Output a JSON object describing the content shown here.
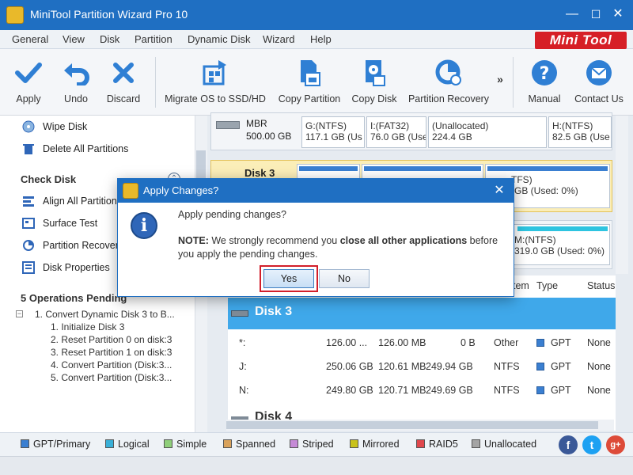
{
  "window": {
    "title": "MiniTool Partition Wizard Pro 10",
    "minimize": "—",
    "maximize": "☐",
    "close": "✕"
  },
  "menu": [
    "General",
    "View",
    "Disk",
    "Partition",
    "Dynamic Disk",
    "Wizard",
    "Help"
  ],
  "logo": "Mini Tool",
  "toolbar": {
    "apply": "Apply",
    "undo": "Undo",
    "discard": "Discard",
    "migrate": "Migrate OS to SSD/HD",
    "copy_partition": "Copy Partition",
    "copy_disk": "Copy Disk",
    "partition_recovery": "Partition Recovery",
    "more": "»",
    "manual": "Manual",
    "contact": "Contact Us"
  },
  "left": {
    "items_top": [
      "Wipe Disk",
      "Delete All Partitions"
    ],
    "check_disk_title": "Check Disk",
    "check_items": [
      "Align All Partitions",
      "Surface Test",
      "Partition Recovery",
      "Disk Properties"
    ],
    "ops_title": "5 Operations Pending",
    "ops": [
      "1. Convert Dynamic Disk 3 to B...",
      "1. Initialize Disk 3",
      "2. Reset Partition 0 on disk:3",
      "3. Reset Partition 1 on disk:3",
      "4. Convert Partition (Disk:3...",
      "5. Convert Partition (Disk:3..."
    ]
  },
  "disk2": {
    "type": "MBR",
    "size": "500.00 GB",
    "parts": [
      {
        "name": "G:(NTFS)",
        "detail": "117.1 GB (Us"
      },
      {
        "name": "I:(FAT32)",
        "detail": "76.0 GB (Use"
      },
      {
        "name": "(Unallocated)",
        "detail": "224.4 GB"
      },
      {
        "name": "H:(NTFS)",
        "detail": "82.5 GB (Use"
      }
    ]
  },
  "disk3": {
    "label": "Disk 3",
    "parts": [
      {
        "name": "TFS)",
        "detail": "GB (Used: 0%)"
      }
    ]
  },
  "disk4card": {
    "name": "M:(NTFS)",
    "detail": "319.0 GB (Used: 0%)"
  },
  "table": {
    "headers": [
      "tem",
      "Type",
      "Status"
    ],
    "disk3_label": "Disk 3",
    "rows": [
      {
        "partition": "*:",
        "capacity": "126.00 ...",
        "used": "126.00 MB",
        "unused": "0 B",
        "fs": "Other",
        "type": "GPT",
        "status": "None"
      },
      {
        "partition": "J:",
        "capacity": "250.06 GB",
        "used": "120.61 MB",
        "unused": "249.94 GB",
        "fs": "NTFS",
        "type": "GPT",
        "status": "None"
      },
      {
        "partition": "N:",
        "capacity": "249.80 GB",
        "used": "120.71 MB",
        "unused": "249.69 GB",
        "fs": "NTFS",
        "type": "GPT",
        "status": "None"
      }
    ],
    "disk4_label": "Disk 4"
  },
  "legend": [
    {
      "label": "GPT/Primary",
      "color": "#3a7fd1"
    },
    {
      "label": "Logical",
      "color": "#39b0d8"
    },
    {
      "label": "Simple",
      "color": "#8fcf7a"
    },
    {
      "label": "Spanned",
      "color": "#d9a25b"
    },
    {
      "label": "Striped",
      "color": "#c58ad6"
    },
    {
      "label": "Mirrored",
      "color": "#c9c21a"
    },
    {
      "label": "RAID5",
      "color": "#e0474c"
    },
    {
      "label": "Unallocated",
      "color": "#a4a4a4"
    }
  ],
  "social": {
    "facebook": "f",
    "twitter": "t",
    "google": "g+"
  },
  "dialog": {
    "title": "Apply Changes?",
    "close": "✕",
    "message": "Apply pending changes?",
    "note_label": "NOTE:",
    "note_a": " We strongly recommend you ",
    "note_bold": "close all other applications",
    "note_b": " before you apply the pending changes.",
    "yes": "Yes",
    "no": "No"
  }
}
